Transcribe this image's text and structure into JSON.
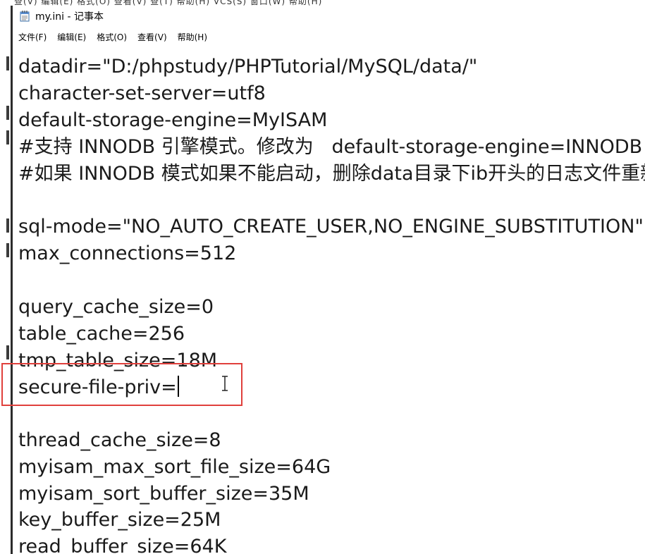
{
  "window": {
    "title": "my.ini - 记事本"
  },
  "menu": {
    "items": [
      {
        "label": "文件(F)"
      },
      {
        "label": "编辑(E)"
      },
      {
        "label": "格式(O)"
      },
      {
        "label": "查看(V)"
      },
      {
        "label": "帮助(H)"
      }
    ]
  },
  "behind": {
    "text": "查(V)   编辑(E)   格式(O)   查看(V)   查(T)   帮助(H)   VCS(S)   窗口(W)   帮助(H)"
  },
  "editor": {
    "lines": [
      "datadir=\"D:/phpstudy/PHPTutorial/MySQL/data/\"",
      "character-set-server=utf8",
      "default-storage-engine=MyISAM",
      "#支持 INNODB 引擎模式。修改为   default-storage-engine=INNODB",
      "#如果 INNODB 模式如果不能启动，删除data目录下ib开头的日志文件重新启动。",
      "",
      "sql-mode=\"NO_AUTO_CREATE_USER,NO_ENGINE_SUBSTITUTION\"",
      "max_connections=512",
      "",
      "query_cache_size=0",
      "table_cache=256",
      "tmp_table_size=18M",
      "secure-file-priv=",
      "",
      "thread_cache_size=8",
      "myisam_max_sort_file_size=64G",
      "myisam_sort_buffer_size=35M",
      "key_buffer_size=25M",
      "read_buffer_size=64K"
    ],
    "highlighted_line_index": 12
  },
  "colors": {
    "highlight_box": "#e0403c",
    "text": "#1a1a1a",
    "background": "#ffffff"
  }
}
